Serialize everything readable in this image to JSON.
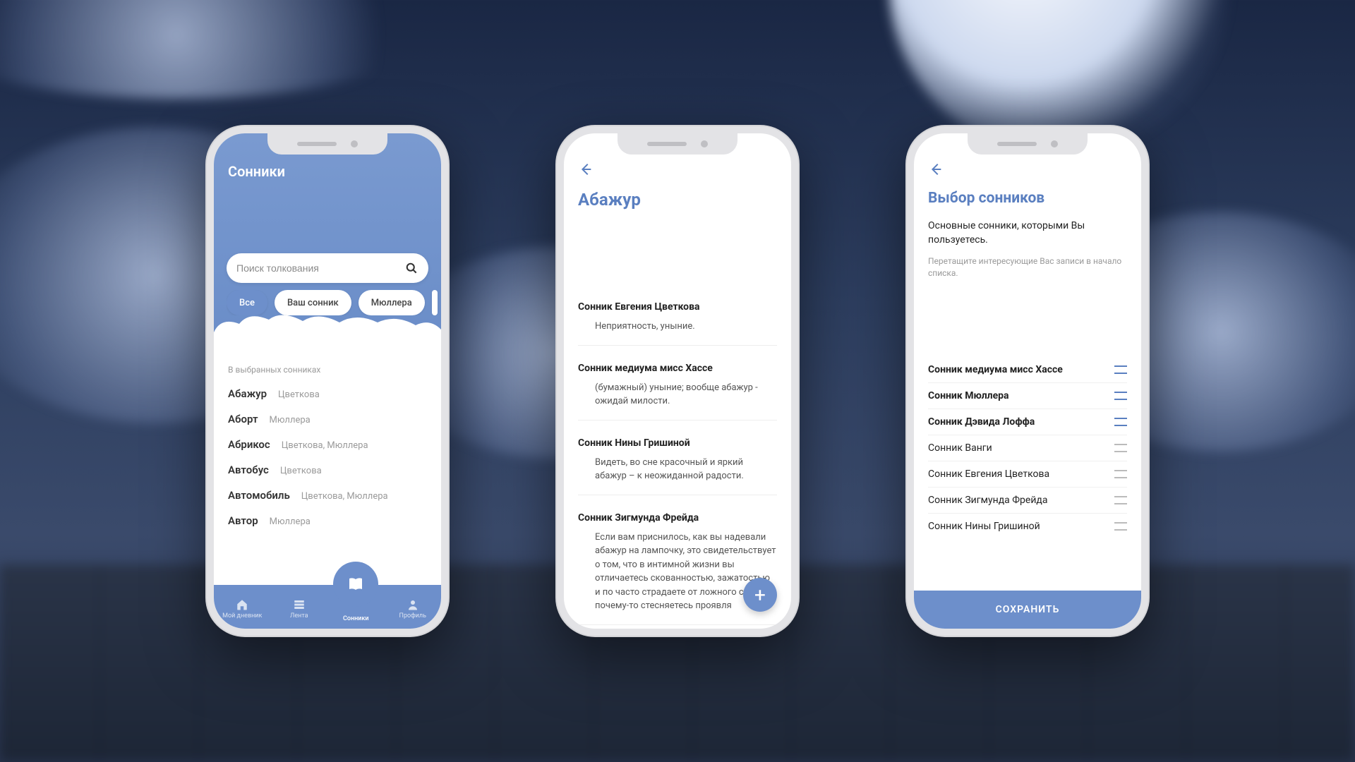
{
  "phone1": {
    "title": "Сонники",
    "search_placeholder": "Поиск толкования",
    "chips": [
      {
        "label": "Все",
        "active": true
      },
      {
        "label": "Ваш сонник",
        "active": false
      },
      {
        "label": "Мюллера",
        "active": false
      }
    ],
    "section_caption": "В выбранных сонниках",
    "words": [
      {
        "word": "Абажур",
        "meta": "Цветкова"
      },
      {
        "word": "Аборт",
        "meta": "Мюллера"
      },
      {
        "word": "Абрикос",
        "meta": "Цветкова, Мюллера"
      },
      {
        "word": "Автобус",
        "meta": "Цветкова"
      },
      {
        "word": "Автомобиль",
        "meta": "Цветкова, Мюллера"
      },
      {
        "word": "Автор",
        "meta": "Мюллера"
      }
    ],
    "nav": [
      {
        "label": "Мой дневник"
      },
      {
        "label": "Лента"
      },
      {
        "label": "Сонники"
      },
      {
        "label": "Профиль"
      }
    ]
  },
  "phone2": {
    "title": "Абажур",
    "interpretations": [
      {
        "source": "Сонник Евгения Цветкова",
        "text": "Неприятность, уныние."
      },
      {
        "source": "Сонник медиума мисс Хассе",
        "text": "(бумажный) уныние; вообще абажур - ожидай милости."
      },
      {
        "source": "Сонник Нины Гришиной",
        "text": "Видеть, во сне красочный и яркий абажур – к неожиданной радости."
      },
      {
        "source": "Сонник Зигмунда Фрейда",
        "text": "Если вам приснилось, как вы надевали абажур на лампочку, это свидетельствует о том, что в интимной жизни вы отличаетесь скованностью, зажатостью и по часто страдаете от ложного сты Вы почему-то стесняетесь проявля"
      }
    ],
    "fab_label": "+"
  },
  "phone3": {
    "title": "Выбор сонников",
    "sub": "Основные сонники, которыми Вы пользуетесь.",
    "hint": "Перетащите интересующие Вас записи в начало списка.",
    "items": [
      {
        "label": "Сонник медиума мисс Хассе",
        "selected": true
      },
      {
        "label": "Сонник Мюллера",
        "selected": true
      },
      {
        "label": "Сонник Дэвида Лоффа",
        "selected": true
      },
      {
        "label": "Сонник Ванги",
        "selected": false
      },
      {
        "label": "Сонник Евгения Цветкова",
        "selected": false
      },
      {
        "label": "Сонник Зигмунда Фрейда",
        "selected": false
      },
      {
        "label": "Сонник Нины Гришиной",
        "selected": false
      }
    ],
    "save_label": "СОХРАНИТЬ"
  }
}
